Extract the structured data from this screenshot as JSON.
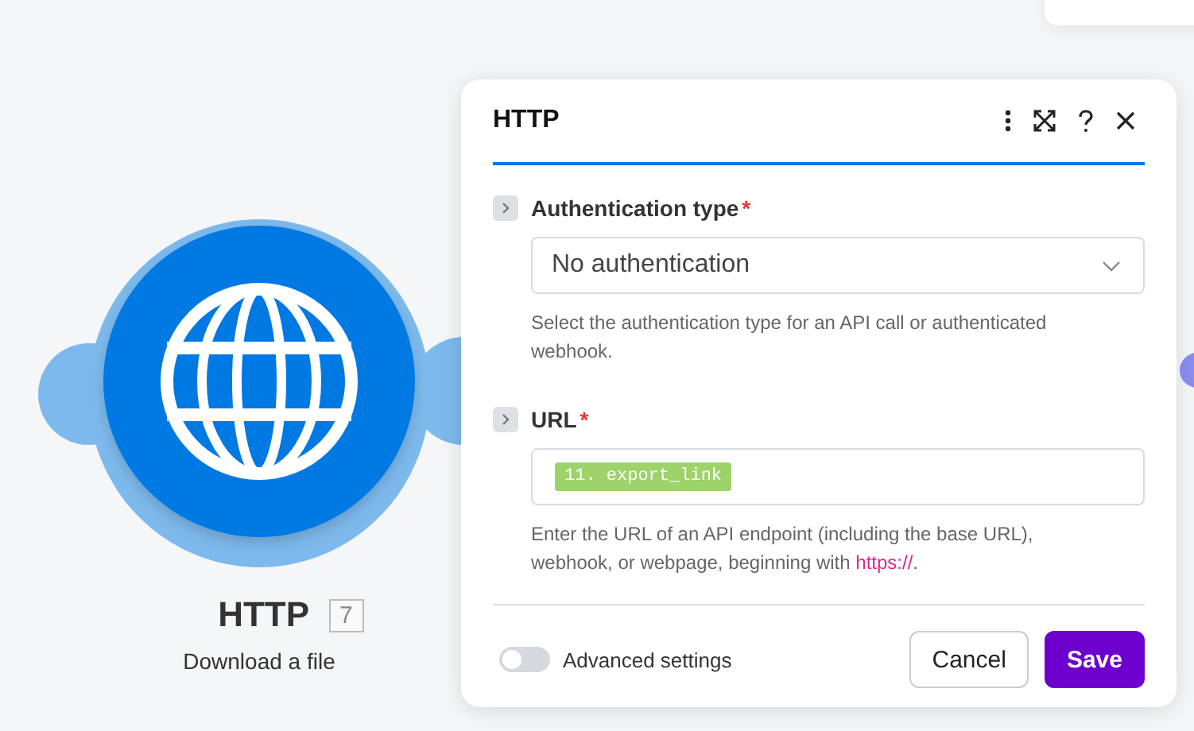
{
  "node": {
    "title": "HTTP",
    "badge": "7",
    "subtitle": "Download a file"
  },
  "dialog": {
    "title": "HTTP",
    "required_mark": "*",
    "fields": [
      {
        "kind": "select",
        "label": "Authentication type",
        "required": true,
        "value": "No authentication",
        "help": "Select the authentication type for an API call or authenticated webhook."
      },
      {
        "kind": "mapped",
        "label": "URL",
        "required": true,
        "value": "11. export_link",
        "help": "Enter the URL of an API endpoint (including the base URL), webhook, or webpage, beginning with ",
        "help_code": "https://",
        "help_tail": "."
      }
    ],
    "advanced": {
      "label": "Advanced settings",
      "on": false
    },
    "buttons": [
      {
        "label": "Cancel",
        "kind": "secondary"
      },
      {
        "label": "Save",
        "kind": "primary"
      }
    ]
  }
}
